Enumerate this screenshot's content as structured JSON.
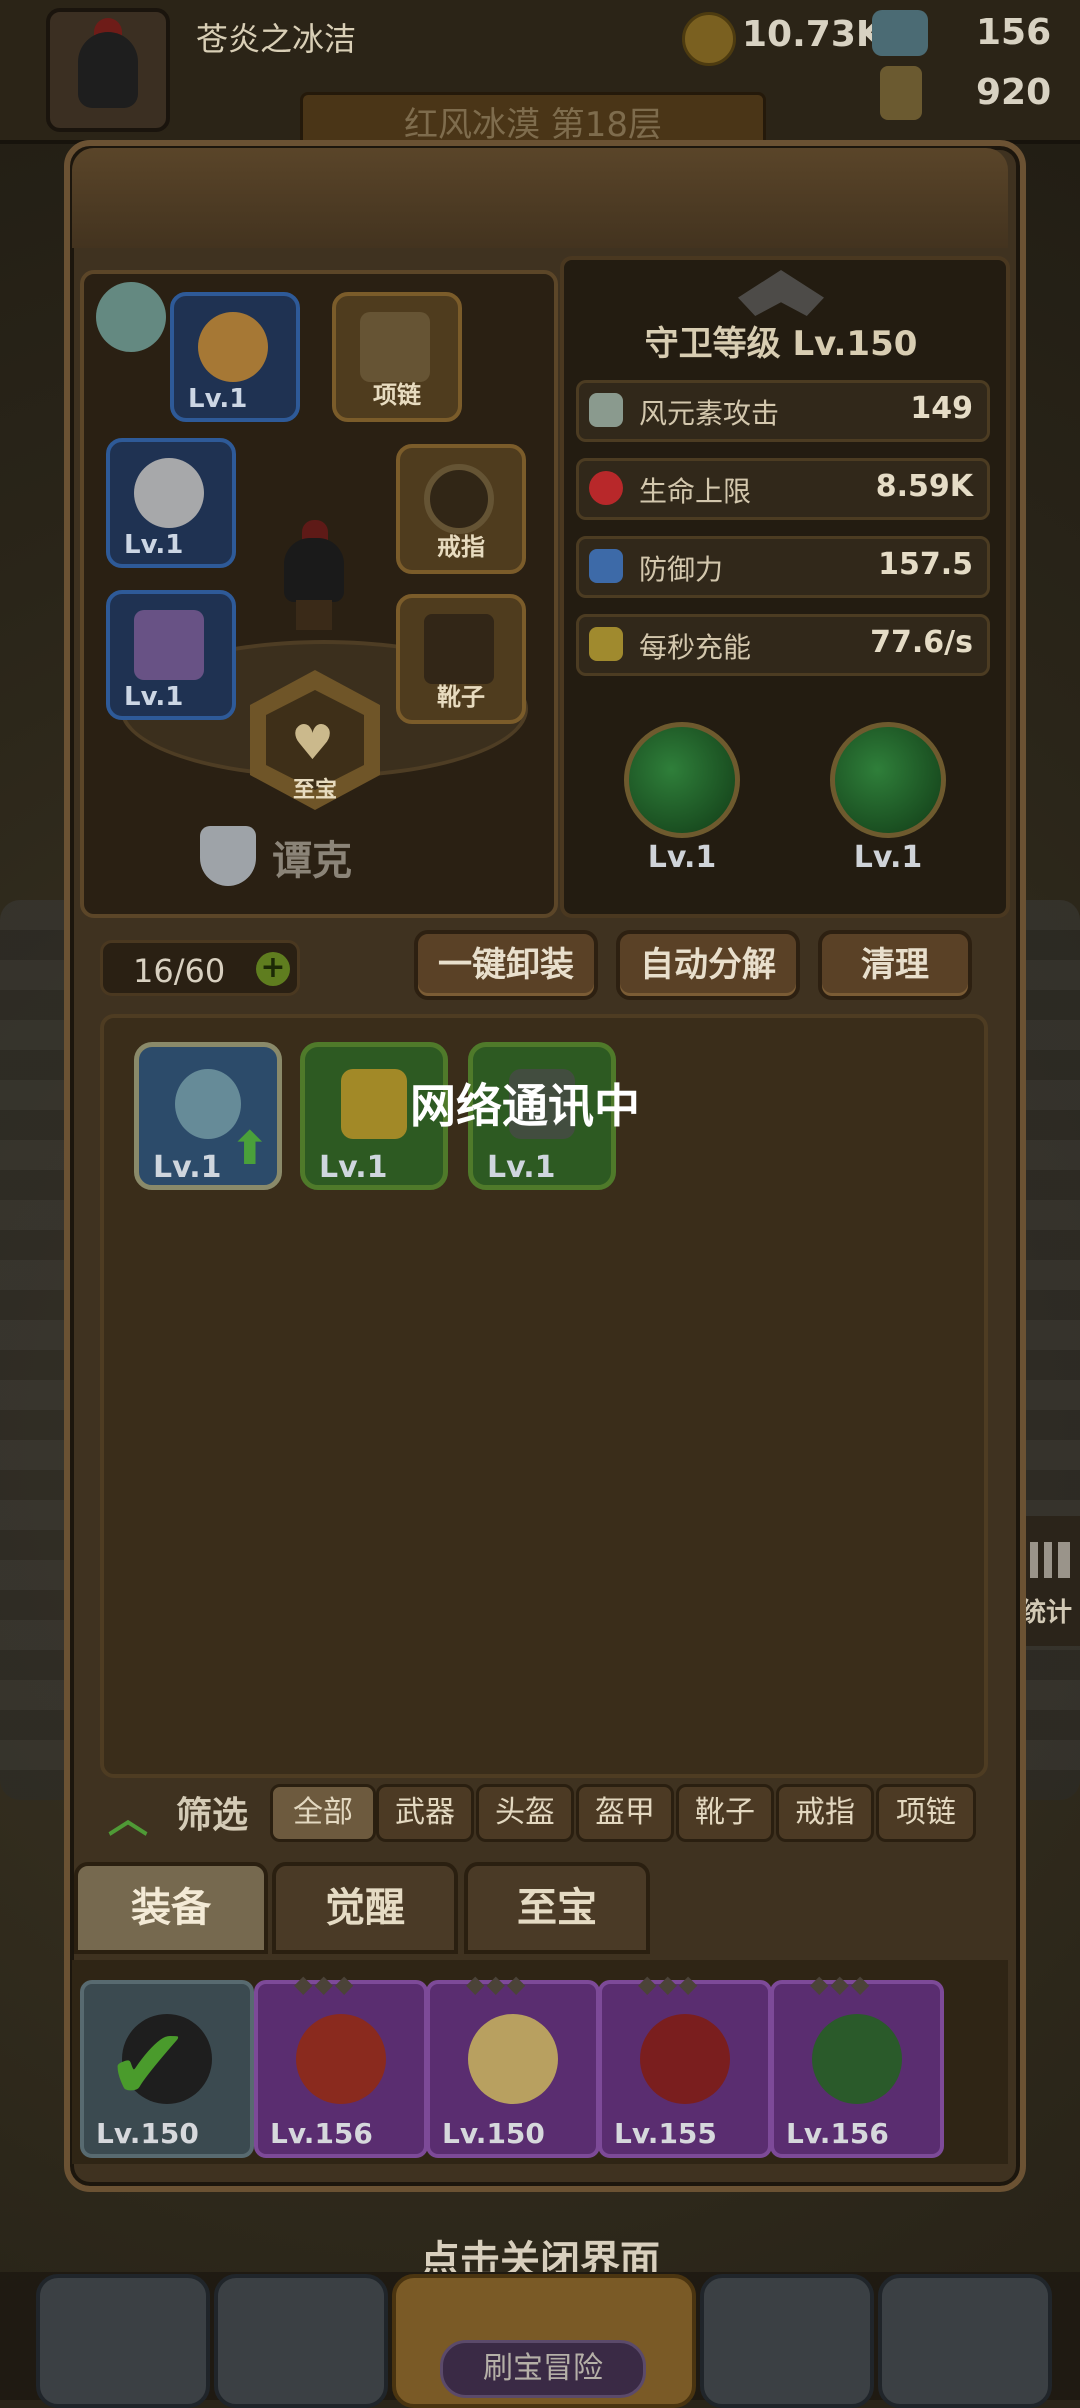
{
  "player": {
    "name": "苍炎之冰洁",
    "gold": "10.73K",
    "gems": "156",
    "stamina": "920"
  },
  "stage_banner": "红风冰漠 第18层",
  "equipment_slots": {
    "weapon": {
      "level": "Lv.1"
    },
    "helmet": {
      "level": "Lv.1"
    },
    "armor": {
      "level": "Lv.1"
    },
    "necklace": {
      "label": "项链"
    },
    "ring": {
      "label": "戒指"
    },
    "boots": {
      "label": "靴子"
    },
    "treasure": {
      "label": "至宝"
    }
  },
  "hero_class": "谭克",
  "guard_level": "守卫等级 Lv.150",
  "stats": [
    {
      "label": "风元素攻击",
      "value": "149",
      "icon": "wind-blade-icon",
      "color": "#8a9a8e"
    },
    {
      "label": "生命上限",
      "value": "8.59K",
      "icon": "heart-icon",
      "color": "#b8282a"
    },
    {
      "label": "防御力",
      "value": "157.5",
      "icon": "shield-icon",
      "color": "#3d6aa8"
    },
    {
      "label": "每秒充能",
      "value": "77.6/s",
      "icon": "sword-icon",
      "color": "#a08a2e"
    }
  ],
  "skills": [
    {
      "level": "Lv.1"
    },
    {
      "level": "Lv.1"
    }
  ],
  "inventory": {
    "capacity": "16/60",
    "buttons": {
      "unequip_all": "一键卸装",
      "auto_decompose": "自动分解",
      "cleanup": "清理"
    },
    "items": [
      {
        "level": "Lv.1",
        "rarity": "blue",
        "upgrade": true
      },
      {
        "level": "Lv.1",
        "rarity": "green",
        "upgrade": false
      },
      {
        "level": "Lv.1",
        "rarity": "green",
        "upgrade": false
      }
    ],
    "loading_text": "网络通讯中"
  },
  "filter": {
    "label": "筛选",
    "tabs": [
      "全部",
      "武器",
      "头盔",
      "盔甲",
      "靴子",
      "戒指",
      "项链"
    ],
    "active": "全部"
  },
  "main_tabs": [
    "装备",
    "觉醒",
    "至宝"
  ],
  "heroes": [
    {
      "level": "Lv.150",
      "selected": true
    },
    {
      "level": "Lv.156",
      "selected": false
    },
    {
      "level": "Lv.150",
      "selected": false
    },
    {
      "level": "Lv.155",
      "selected": false
    },
    {
      "level": "Lv.156",
      "selected": false
    }
  ],
  "close_hint": "点击关闭界面",
  "bottom_nav": {
    "center_label": "刷宝冒险"
  },
  "side": {
    "stats_label": "统计"
  },
  "colors": {
    "accent_green": "#4a9b2c",
    "panel_brown": "#3f3220",
    "border_brown": "#6b5233"
  }
}
